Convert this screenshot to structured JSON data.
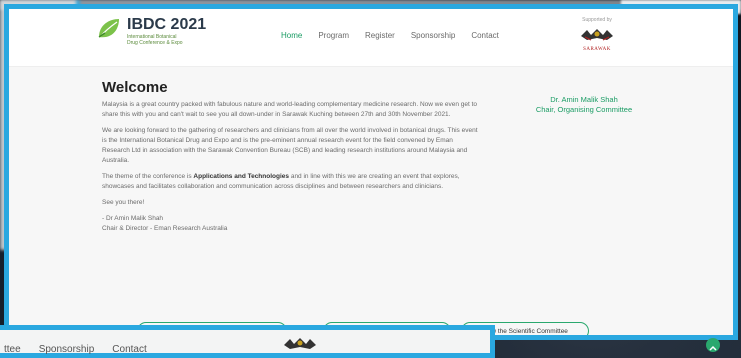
{
  "brand": {
    "title": "IBDC 2021",
    "subtitle_line1": "International Botanical",
    "subtitle_line2": "Drug Conference & Expo"
  },
  "nav": {
    "items": [
      {
        "label": "Home",
        "active": true
      },
      {
        "label": "Program",
        "active": false
      },
      {
        "label": "Register",
        "active": false
      },
      {
        "label": "Sponsorship",
        "active": false
      },
      {
        "label": "Contact",
        "active": false
      }
    ]
  },
  "sponsor": {
    "caption": "Supported by",
    "name": "SARAWAK",
    "icon": "sarawak-emblem-icon"
  },
  "main": {
    "heading": "Welcome",
    "paragraphs": [
      "Malaysia is a great country packed with fabulous nature and world-leading complementary medicine research. Now we even get to share this with you and can't wait to see you all down-under in Sarawak Kuching between 27th and 30th November 2021.",
      "We are looking forward to the gathering of researchers and clinicians from all over the world involved in botanical drugs. This event is the International Botanical Drug and Expo and is the pre-eminent annual research event for the field convened by Eman Research Ltd in association with the Sarawak Convention Bureau (SCB) and leading research institutions around Malaysia and Australia.",
      "The theme of the conference is",
      "Applications and Technologies",
      "and in line with this we are creating an event that explores, showcases and facilitates collaboration and communication across disciplines and between researchers and clinicians.",
      "See you there!",
      "- Dr Amin Malik Shah",
      "Chair & Director - Eman Research Australia"
    ]
  },
  "chair": {
    "name": "Dr. Amin Malik Shah",
    "role": "Chair, Organising Committee"
  },
  "buttons": {
    "pill1": "",
    "pill2": "",
    "pill3": "View the Scientific Committee"
  },
  "ghost": {
    "nav": [
      "ttee",
      "Sponsorship",
      "Contact"
    ]
  },
  "colors": {
    "accent": "#1a9c64",
    "frame": "#2aa8e0"
  }
}
